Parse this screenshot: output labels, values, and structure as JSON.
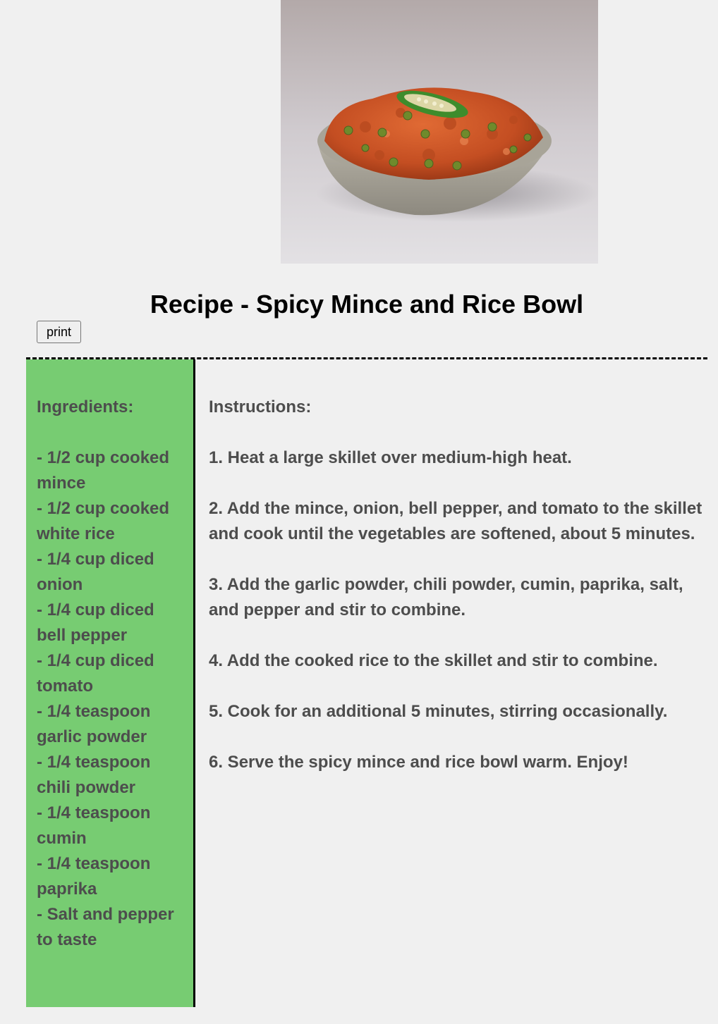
{
  "title": "Recipe - Spicy Mince and Rice Bowl",
  "print_label": "print",
  "ingredients": {
    "heading": "Ingredients:",
    "items": [
      "- 1/2 cup cooked mince",
      "- 1/2 cup cooked white rice",
      "- 1/4 cup diced onion",
      "- 1/4 cup diced bell pepper",
      "- 1/4 cup diced tomato",
      "- 1/4 teaspoon garlic powder",
      "- 1/4 teaspoon chili powder",
      "- 1/4 teaspoon cumin",
      "- 1/4 teaspoon paprika",
      "- Salt and pepper to taste"
    ]
  },
  "instructions": {
    "heading": "Instructions:",
    "steps": [
      "1. Heat a large skillet over medium-high heat.",
      "2. Add the mince, onion, bell pepper, and tomato to the skillet and cook until the vegetables are softened, about 5 minutes.",
      "3. Add the garlic powder, chili powder, cumin, paprika, salt, and pepper and stir to combine.",
      "4. Add the cooked rice to the skillet and stir to combine.",
      "5. Cook for an additional 5 minutes, stirring occasionally.",
      "6. Serve the spicy mince and rice bowl warm. Enjoy!"
    ]
  },
  "colors": {
    "page_background": "#f0f0f0",
    "sidebar_background": "#77cc72",
    "body_text": "#4d4d4d"
  }
}
